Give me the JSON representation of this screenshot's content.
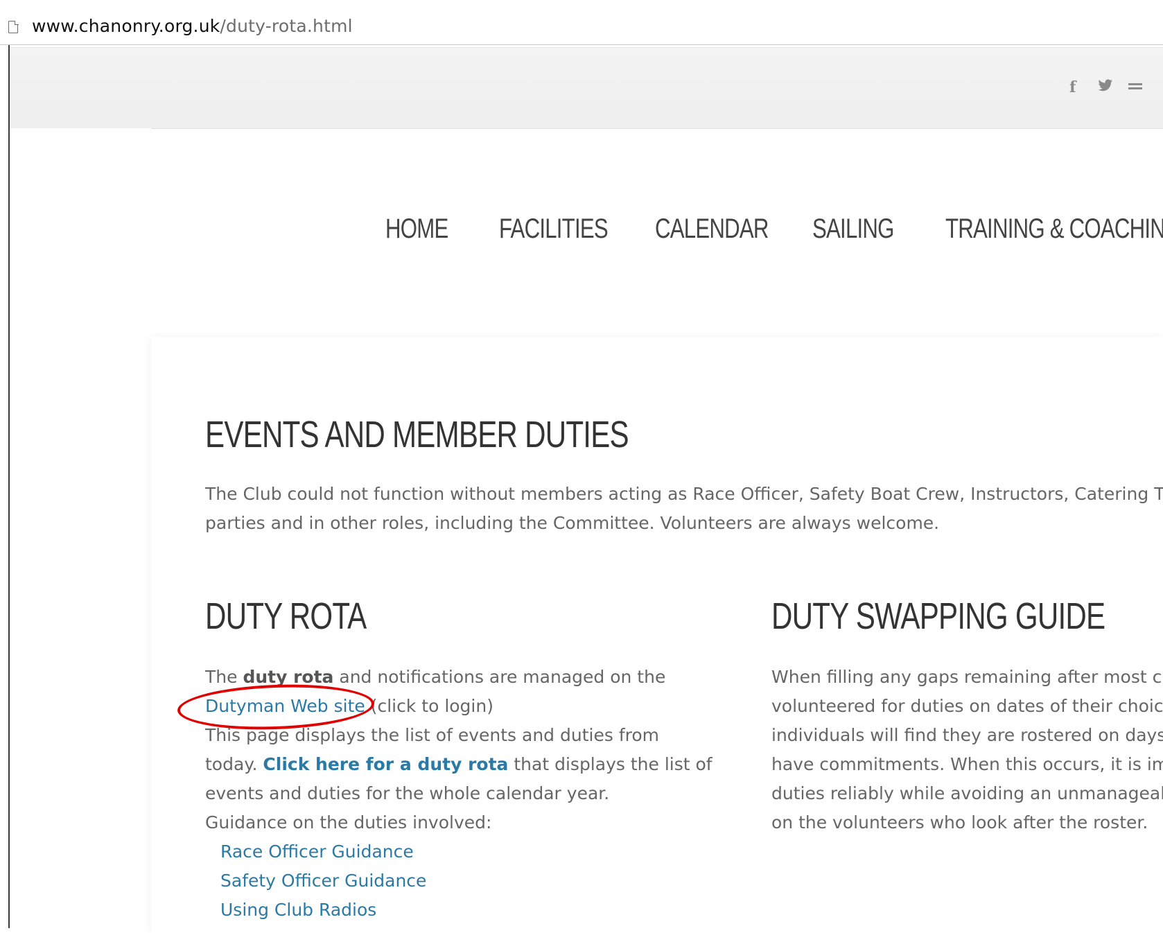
{
  "browser": {
    "url_domain": "www.chanonry.org.uk",
    "url_path": "/duty-rota.html"
  },
  "social_icons": [
    "facebook-icon",
    "twitter-icon",
    "email-icon"
  ],
  "nav": {
    "items": [
      "HOME",
      "FACILITIES",
      "CALENDAR",
      "SAILING",
      "TRAINING & COACHING"
    ]
  },
  "events": {
    "title": "EVENTS AND MEMBER DUTIES",
    "line1": "The Club could not function without members acting as Race Officer, Safety Boat Crew, Instructors, Catering T",
    "line2": "parties and in other roles, including the Committee. Volunteers are always welcome."
  },
  "duty_rota": {
    "title": "DUTY ROTA",
    "l1_pre": "The ",
    "l1_bold": "duty rota",
    "l1_post": " and notifications are managed on the",
    "l2_link": "Dutyman Web site",
    "l2_post": " (click to login)",
    "l3": "This page displays the list of events and duties from",
    "l4_pre": "today. ",
    "l4_link": "Click here for a duty rota",
    "l4_post": " that displays the list of",
    "l5": "events and duties for the whole calendar year.",
    "l6": "Guidance on the duties involved:",
    "guides": [
      "Race Officer Guidance",
      "Safety Officer Guidance",
      "Using Club Radios"
    ]
  },
  "swapping": {
    "title": "DUTY SWAPPING GUIDE",
    "lines": [
      "When filling any gaps remaining after most cl",
      "volunteered for duties on dates of their choic",
      "individuals will find they are rostered on days",
      "have commitments. When this occurs, it is im",
      "duties reliably while avoiding an unmanageal",
      "on the volunteers who look after the roster."
    ]
  },
  "annotation": {
    "color": "#e00000"
  }
}
